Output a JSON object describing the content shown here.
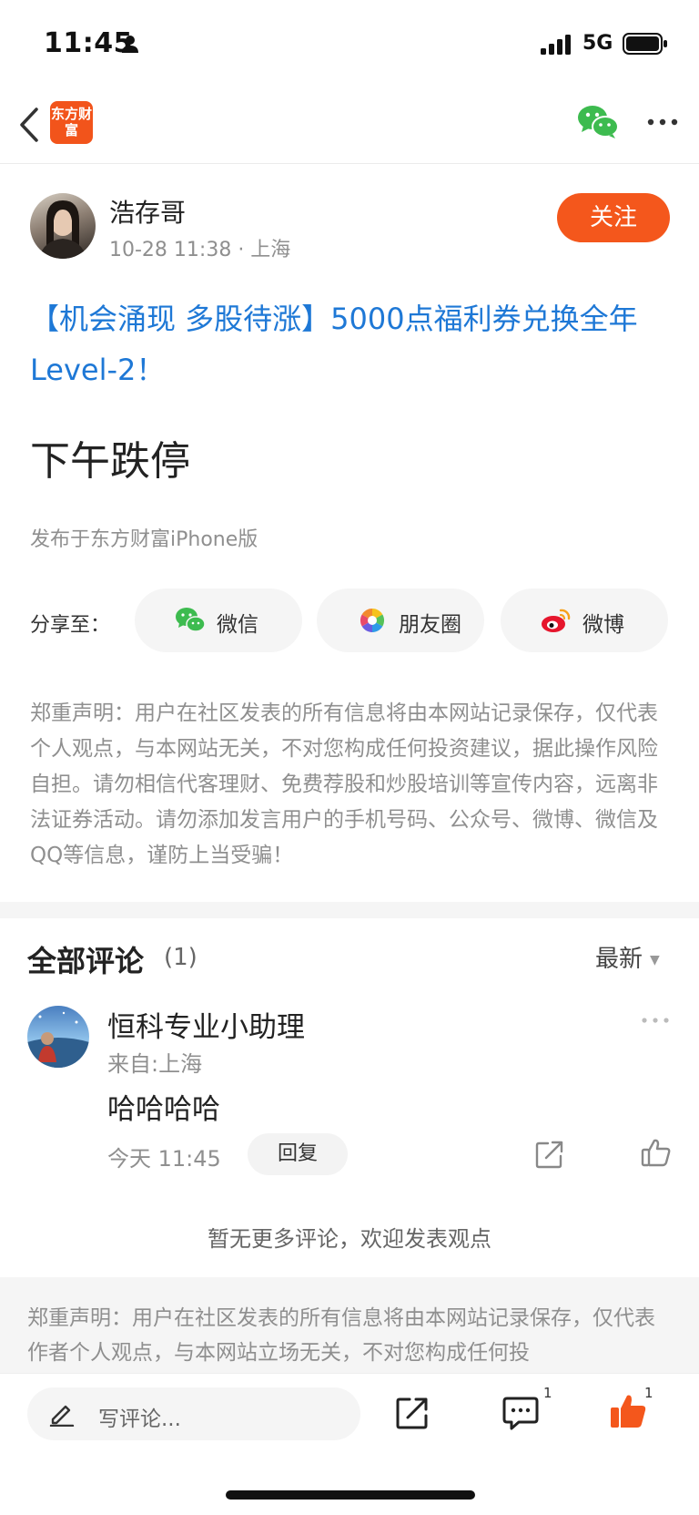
{
  "status_bar": {
    "time": "11:45",
    "network": "5G"
  },
  "nav": {
    "logo_text": "东方财富"
  },
  "author": {
    "name": "浩存哥",
    "meta": "10-28 11:38 · 上海",
    "follow_label": "关注"
  },
  "post": {
    "topic_link": "【机会涌现 多股待涨】5000点福利券兑换全年Level-2！",
    "body": "下午跌停",
    "source": "发布于东方财富iPhone版"
  },
  "share": {
    "label": "分享至：",
    "targets": [
      {
        "label": "微信",
        "icon": "wechat-icon"
      },
      {
        "label": "朋友圈",
        "icon": "moments-icon"
      },
      {
        "label": "微博",
        "icon": "weibo-icon"
      }
    ]
  },
  "disclaimer_top": "郑重声明：用户在社区发表的所有信息将由本网站记录保存，仅代表个人观点，与本网站无关，不对您构成任何投资建议，据此操作风险自担。请勿相信代客理财、免费荐股和炒股培训等宣传内容，远离非法证券活动。请勿添加发言用户的手机号码、公众号、微博、微信及QQ等信息，谨防上当受骗！",
  "comments": {
    "title": "全部评论",
    "count": "(1)",
    "sort_label": "最新",
    "items": [
      {
        "name": "恒科专业小助理",
        "location": "来自:上海",
        "text": "哈哈哈哈",
        "time": "今天 11:45",
        "reply_label": "回复"
      }
    ],
    "no_more": "暂无更多评论，欢迎发表观点"
  },
  "disclaimer_bottom": "郑重声明：用户在社区发表的所有信息将由本网站记录保存，仅代表作者个人观点，与本网站立场无关，不对您构成任何投",
  "bottom_bar": {
    "input_placeholder": "写评论...",
    "comment_count": "1",
    "like_count": "1"
  },
  "colors": {
    "accent": "#f4571c",
    "link": "#1e78d6",
    "wechat_green": "#3dbb4f",
    "muted": "#8f8f8f"
  }
}
